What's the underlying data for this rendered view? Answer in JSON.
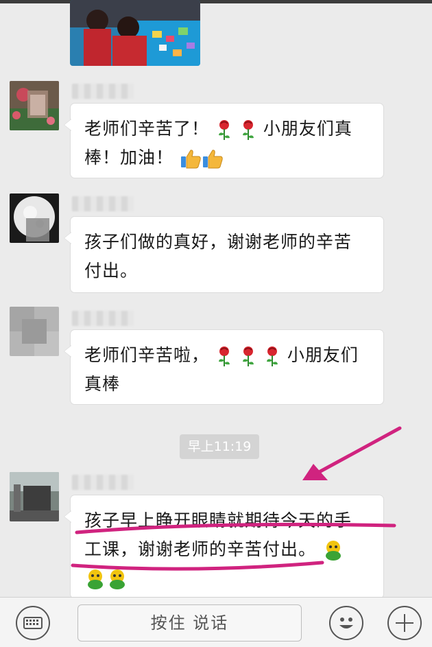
{
  "messages": [
    {
      "text_line1": "老师们辛苦了！",
      "text_line1b": "小朋友们真",
      "text_line2": "棒！加油！"
    },
    {
      "text_line1": "孩子们做的真好，谢谢老师的辛苦",
      "text_line2": "付出。"
    },
    {
      "text_line1": "老师们辛苦啦，",
      "text_line1b": "小朋友们",
      "text_line2": "真棒"
    },
    {
      "text_line1": "孩子早上睁开眼睛就期待今天的手",
      "text_line2": "工课，谢谢老师的辛苦付出。"
    }
  ],
  "timestamp": "早上11:19",
  "input_bar": {
    "hold_to_talk_label": "按住 说话"
  },
  "icons": {
    "rose": "rose-emoji",
    "thumbs_up": "thumbs-up-emoji",
    "frog": "green-frog-emoji",
    "keyboard": "keyboard-icon",
    "smiley": "smiley-icon",
    "plus": "plus-icon"
  },
  "colors": {
    "chat_background": "#ebebeb",
    "bubble": "#ffffff",
    "annotation": "#d0237f",
    "timestamp_pill": "#d4d4d4"
  }
}
